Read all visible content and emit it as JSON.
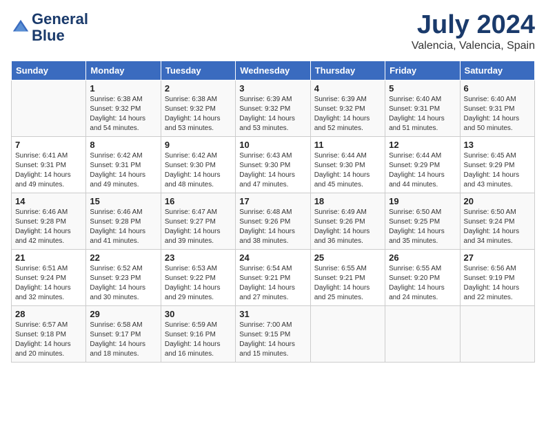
{
  "header": {
    "logo_line1": "General",
    "logo_line2": "Blue",
    "month_year": "July 2024",
    "location": "Valencia, Valencia, Spain"
  },
  "days_of_week": [
    "Sunday",
    "Monday",
    "Tuesday",
    "Wednesday",
    "Thursday",
    "Friday",
    "Saturday"
  ],
  "weeks": [
    [
      {
        "day": "",
        "sunrise": "",
        "sunset": "",
        "daylight": ""
      },
      {
        "day": "1",
        "sunrise": "Sunrise: 6:38 AM",
        "sunset": "Sunset: 9:32 PM",
        "daylight": "Daylight: 14 hours and 54 minutes."
      },
      {
        "day": "2",
        "sunrise": "Sunrise: 6:38 AM",
        "sunset": "Sunset: 9:32 PM",
        "daylight": "Daylight: 14 hours and 53 minutes."
      },
      {
        "day": "3",
        "sunrise": "Sunrise: 6:39 AM",
        "sunset": "Sunset: 9:32 PM",
        "daylight": "Daylight: 14 hours and 53 minutes."
      },
      {
        "day": "4",
        "sunrise": "Sunrise: 6:39 AM",
        "sunset": "Sunset: 9:32 PM",
        "daylight": "Daylight: 14 hours and 52 minutes."
      },
      {
        "day": "5",
        "sunrise": "Sunrise: 6:40 AM",
        "sunset": "Sunset: 9:31 PM",
        "daylight": "Daylight: 14 hours and 51 minutes."
      },
      {
        "day": "6",
        "sunrise": "Sunrise: 6:40 AM",
        "sunset": "Sunset: 9:31 PM",
        "daylight": "Daylight: 14 hours and 50 minutes."
      }
    ],
    [
      {
        "day": "7",
        "sunrise": "Sunrise: 6:41 AM",
        "sunset": "Sunset: 9:31 PM",
        "daylight": "Daylight: 14 hours and 49 minutes."
      },
      {
        "day": "8",
        "sunrise": "Sunrise: 6:42 AM",
        "sunset": "Sunset: 9:31 PM",
        "daylight": "Daylight: 14 hours and 49 minutes."
      },
      {
        "day": "9",
        "sunrise": "Sunrise: 6:42 AM",
        "sunset": "Sunset: 9:30 PM",
        "daylight": "Daylight: 14 hours and 48 minutes."
      },
      {
        "day": "10",
        "sunrise": "Sunrise: 6:43 AM",
        "sunset": "Sunset: 9:30 PM",
        "daylight": "Daylight: 14 hours and 47 minutes."
      },
      {
        "day": "11",
        "sunrise": "Sunrise: 6:44 AM",
        "sunset": "Sunset: 9:30 PM",
        "daylight": "Daylight: 14 hours and 45 minutes."
      },
      {
        "day": "12",
        "sunrise": "Sunrise: 6:44 AM",
        "sunset": "Sunset: 9:29 PM",
        "daylight": "Daylight: 14 hours and 44 minutes."
      },
      {
        "day": "13",
        "sunrise": "Sunrise: 6:45 AM",
        "sunset": "Sunset: 9:29 PM",
        "daylight": "Daylight: 14 hours and 43 minutes."
      }
    ],
    [
      {
        "day": "14",
        "sunrise": "Sunrise: 6:46 AM",
        "sunset": "Sunset: 9:28 PM",
        "daylight": "Daylight: 14 hours and 42 minutes."
      },
      {
        "day": "15",
        "sunrise": "Sunrise: 6:46 AM",
        "sunset": "Sunset: 9:28 PM",
        "daylight": "Daylight: 14 hours and 41 minutes."
      },
      {
        "day": "16",
        "sunrise": "Sunrise: 6:47 AM",
        "sunset": "Sunset: 9:27 PM",
        "daylight": "Daylight: 14 hours and 39 minutes."
      },
      {
        "day": "17",
        "sunrise": "Sunrise: 6:48 AM",
        "sunset": "Sunset: 9:26 PM",
        "daylight": "Daylight: 14 hours and 38 minutes."
      },
      {
        "day": "18",
        "sunrise": "Sunrise: 6:49 AM",
        "sunset": "Sunset: 9:26 PM",
        "daylight": "Daylight: 14 hours and 36 minutes."
      },
      {
        "day": "19",
        "sunrise": "Sunrise: 6:50 AM",
        "sunset": "Sunset: 9:25 PM",
        "daylight": "Daylight: 14 hours and 35 minutes."
      },
      {
        "day": "20",
        "sunrise": "Sunrise: 6:50 AM",
        "sunset": "Sunset: 9:24 PM",
        "daylight": "Daylight: 14 hours and 34 minutes."
      }
    ],
    [
      {
        "day": "21",
        "sunrise": "Sunrise: 6:51 AM",
        "sunset": "Sunset: 9:24 PM",
        "daylight": "Daylight: 14 hours and 32 minutes."
      },
      {
        "day": "22",
        "sunrise": "Sunrise: 6:52 AM",
        "sunset": "Sunset: 9:23 PM",
        "daylight": "Daylight: 14 hours and 30 minutes."
      },
      {
        "day": "23",
        "sunrise": "Sunrise: 6:53 AM",
        "sunset": "Sunset: 9:22 PM",
        "daylight": "Daylight: 14 hours and 29 minutes."
      },
      {
        "day": "24",
        "sunrise": "Sunrise: 6:54 AM",
        "sunset": "Sunset: 9:21 PM",
        "daylight": "Daylight: 14 hours and 27 minutes."
      },
      {
        "day": "25",
        "sunrise": "Sunrise: 6:55 AM",
        "sunset": "Sunset: 9:21 PM",
        "daylight": "Daylight: 14 hours and 25 minutes."
      },
      {
        "day": "26",
        "sunrise": "Sunrise: 6:55 AM",
        "sunset": "Sunset: 9:20 PM",
        "daylight": "Daylight: 14 hours and 24 minutes."
      },
      {
        "day": "27",
        "sunrise": "Sunrise: 6:56 AM",
        "sunset": "Sunset: 9:19 PM",
        "daylight": "Daylight: 14 hours and 22 minutes."
      }
    ],
    [
      {
        "day": "28",
        "sunrise": "Sunrise: 6:57 AM",
        "sunset": "Sunset: 9:18 PM",
        "daylight": "Daylight: 14 hours and 20 minutes."
      },
      {
        "day": "29",
        "sunrise": "Sunrise: 6:58 AM",
        "sunset": "Sunset: 9:17 PM",
        "daylight": "Daylight: 14 hours and 18 minutes."
      },
      {
        "day": "30",
        "sunrise": "Sunrise: 6:59 AM",
        "sunset": "Sunset: 9:16 PM",
        "daylight": "Daylight: 14 hours and 16 minutes."
      },
      {
        "day": "31",
        "sunrise": "Sunrise: 7:00 AM",
        "sunset": "Sunset: 9:15 PM",
        "daylight": "Daylight: 14 hours and 15 minutes."
      },
      {
        "day": "",
        "sunrise": "",
        "sunset": "",
        "daylight": ""
      },
      {
        "day": "",
        "sunrise": "",
        "sunset": "",
        "daylight": ""
      },
      {
        "day": "",
        "sunrise": "",
        "sunset": "",
        "daylight": ""
      }
    ]
  ]
}
